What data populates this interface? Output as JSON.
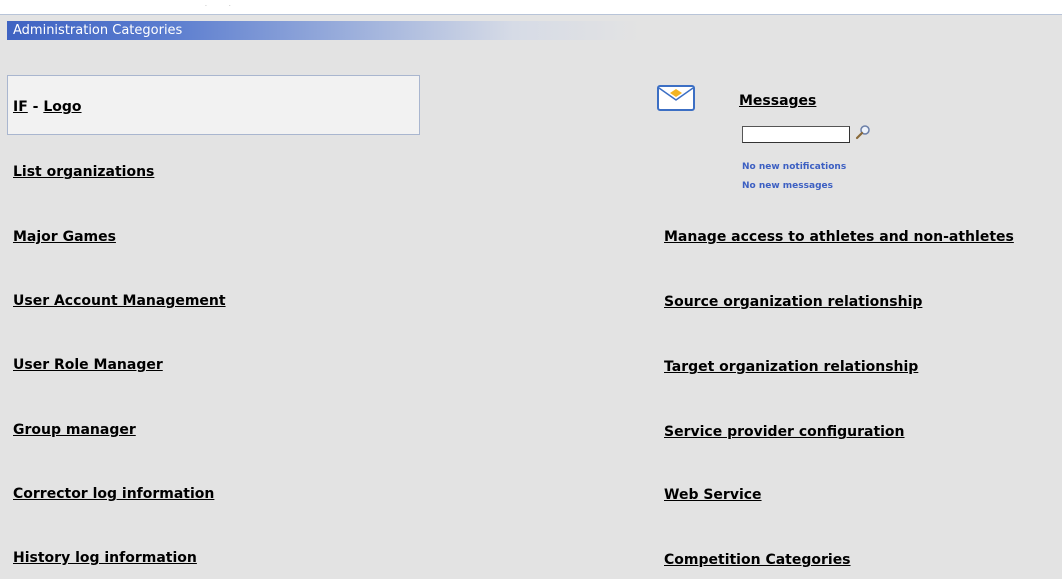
{
  "header": {
    "title": "Administration Categories"
  },
  "logo_box": {
    "part1": "IF",
    "separator": " - ",
    "part2": "Logo"
  },
  "left_links": [
    "List organizations",
    "Major Games",
    "User Account Management",
    "User Role Manager",
    "Group manager",
    "Corrector log information",
    "History log information"
  ],
  "messages": {
    "title": "Messages",
    "search_value": "",
    "notifications": "No new notifications",
    "messages_status": "No new messages"
  },
  "right_links": [
    "Manage access to athletes and non-athletes",
    "Source organization relationship",
    "Target organization relationship",
    "Service provider configuration",
    "Web Service",
    "Competition Categories"
  ],
  "colors": {
    "header_bar": "#3f63c2",
    "notification_text": "#3c5fc2",
    "page_background": "#e3e3e3"
  },
  "icons": {
    "messages": "envelope-icon",
    "search": "search-icon"
  }
}
